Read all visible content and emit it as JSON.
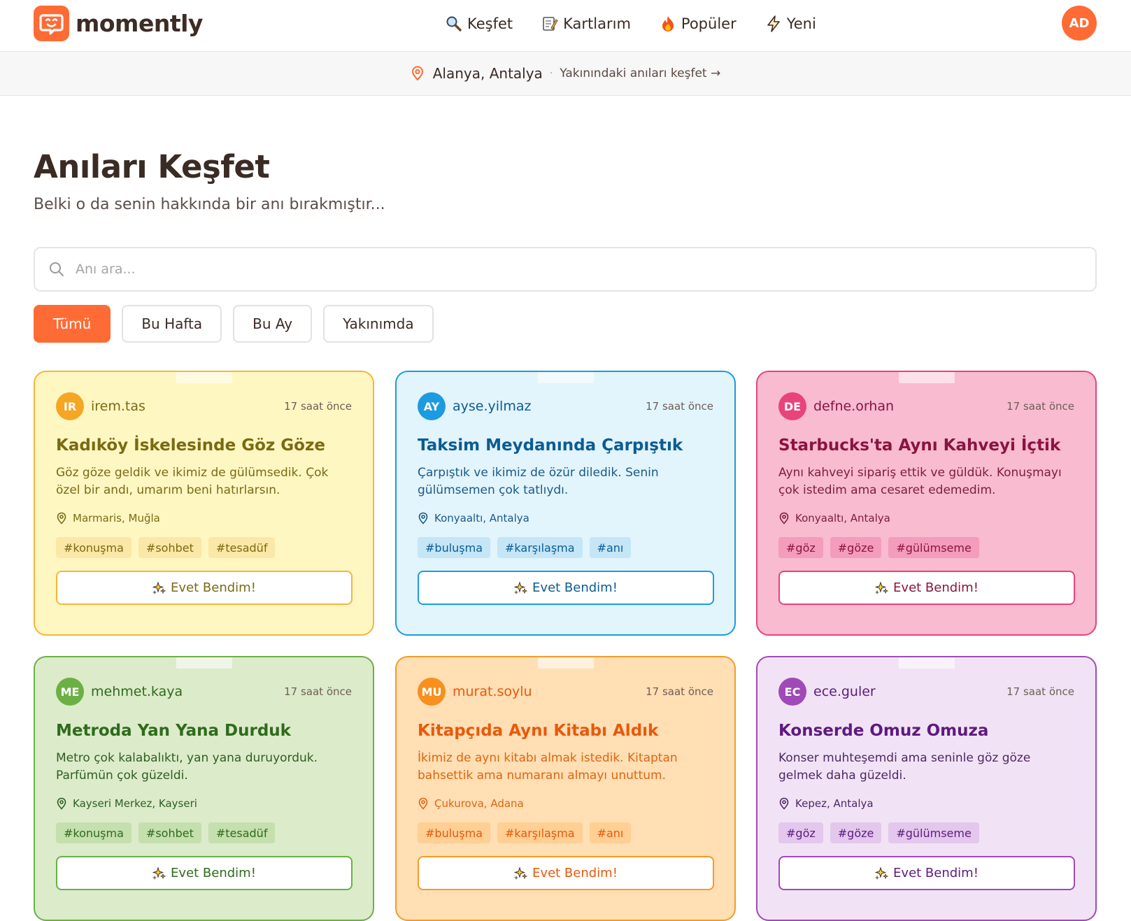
{
  "header": {
    "brand": "momently",
    "nav": [
      {
        "label": "Keşfet",
        "icon": "magnifier-icon"
      },
      {
        "label": "Kartlarım",
        "icon": "memo-icon"
      },
      {
        "label": "Popüler",
        "icon": "fire-icon"
      },
      {
        "label": "Yeni",
        "icon": "lightning-icon"
      }
    ],
    "user_initials": "AD"
  },
  "location_bar": {
    "city": "Alanya, Antalya",
    "separator": "·",
    "link": "Yakınındaki anıları keşfet →"
  },
  "main": {
    "title": "Anıları Keşfet",
    "subtitle": "Belki o da senin hakkında bir anı bırakmıştır...",
    "search_placeholder": "Anı ara...",
    "filters": [
      "Tümü",
      "Bu Hafta",
      "Bu Ay",
      "Yakınımda"
    ],
    "active_filter": "Tümü"
  },
  "cards": [
    {
      "initials": "IR",
      "user": "irem.tas",
      "time": "17 saat önce",
      "title": "Kadıköy İskelesinde Göz Göze",
      "text": "Göz göze geldik ve ikimiz de gülümsedik. Çok özel bir andı, umarım beni hatırlarsın.",
      "location": "Marmaris, Muğla",
      "tags": [
        "#konuşma",
        "#sohbet",
        "#tesadüf"
      ],
      "button": "Evet Bendim!",
      "colors": {
        "bg": "#fff7c2",
        "border": "#f5b53a",
        "accent": "#f6a623",
        "title": "#7a6a12",
        "text": "#7b6b15",
        "tag_bg": "#fbe8a6",
        "tag_text": "#7a6a12"
      }
    },
    {
      "initials": "AY",
      "user": "ayse.yilmaz",
      "time": "17 saat önce",
      "title": "Taksim Meydanında Çarpıştık",
      "text": "Çarpıştık ve ikimiz de özür diledik. Senin gülümsemen çok tatlıydı.",
      "location": "Konyaaltı, Antalya",
      "tags": [
        "#buluşma",
        "#karşılaşma",
        "#anı"
      ],
      "button": "Evet Bendim!",
      "colors": {
        "bg": "#e2f4fc",
        "border": "#1d9be0",
        "accent": "#1d9be0",
        "title": "#0b5c94",
        "text": "#1a5a8a",
        "tag_bg": "#c4e6f7",
        "tag_text": "#0b5c94"
      }
    },
    {
      "initials": "DE",
      "user": "defne.orhan",
      "time": "17 saat önce",
      "title": "Starbucks'ta Aynı Kahveyi İçtik",
      "text": "Aynı kahveyi sipariş ettik ve güldük. Konuşmayı çok istedim ama cesaret edemedim.",
      "location": "Konyaaltı, Antalya",
      "tags": [
        "#göz",
        "#göze",
        "#gülümseme"
      ],
      "button": "Evet Bendim!",
      "colors": {
        "bg": "#f8bbd0",
        "border": "#e8437b",
        "accent": "#e8437b",
        "title": "#8a1440",
        "text": "#7c1d3f",
        "tag_bg": "#f49cbb",
        "tag_text": "#8a1440"
      }
    },
    {
      "initials": "ME",
      "user": "mehmet.kaya",
      "time": "17 saat önce",
      "title": "Metroda Yan Yana Durduk",
      "text": "Metro çok kalabalıktı, yan yana duruyorduk. Parfümün çok güzeldi.",
      "location": "Kayseri Merkez, Kayseri",
      "tags": [
        "#konuşma",
        "#sohbet",
        "#tesadüf"
      ],
      "button": "Evet Bendim!",
      "colors": {
        "bg": "#dcebca",
        "border": "#6cb045",
        "accent": "#6cb045",
        "title": "#2f6b1c",
        "text": "#2f5e22",
        "tag_bg": "#c5dfae",
        "tag_text": "#2f6b1c"
      }
    },
    {
      "initials": "MU",
      "user": "murat.soylu",
      "time": "17 saat önce",
      "title": "Kitapçıda Aynı Kitabı Aldık",
      "text": "İkimiz de aynı kitabı almak istedik. Kitaptan bahsettik ama numaranı almayı unuttum.",
      "location": "Çukurova, Adana",
      "tags": [
        "#buluşma",
        "#karşılaşma",
        "#anı"
      ],
      "button": "Evet Bendim!",
      "colors": {
        "bg": "#ffdfb3",
        "border": "#f59b28",
        "accent": "#f7901e",
        "title": "#e8590c",
        "text": "#e06412",
        "tag_bg": "#ffcf94",
        "tag_text": "#e8590c"
      }
    },
    {
      "initials": "EC",
      "user": "ece.guler",
      "time": "17 saat önce",
      "title": "Konserde Omuz Omuza",
      "text": "Konser muhteşemdi ama seninle göz göze gelmek daha güzeldi.",
      "location": "Kepez, Antalya",
      "tags": [
        "#göz",
        "#göze",
        "#gülümseme"
      ],
      "button": "Evet Bendim!",
      "colors": {
        "bg": "#f1e3f5",
        "border": "#a04ab8",
        "accent": "#a04ab8",
        "title": "#5e1a80",
        "text": "#4e2766",
        "tag_bg": "#e3c7ec",
        "tag_text": "#5e1a80"
      }
    }
  ]
}
